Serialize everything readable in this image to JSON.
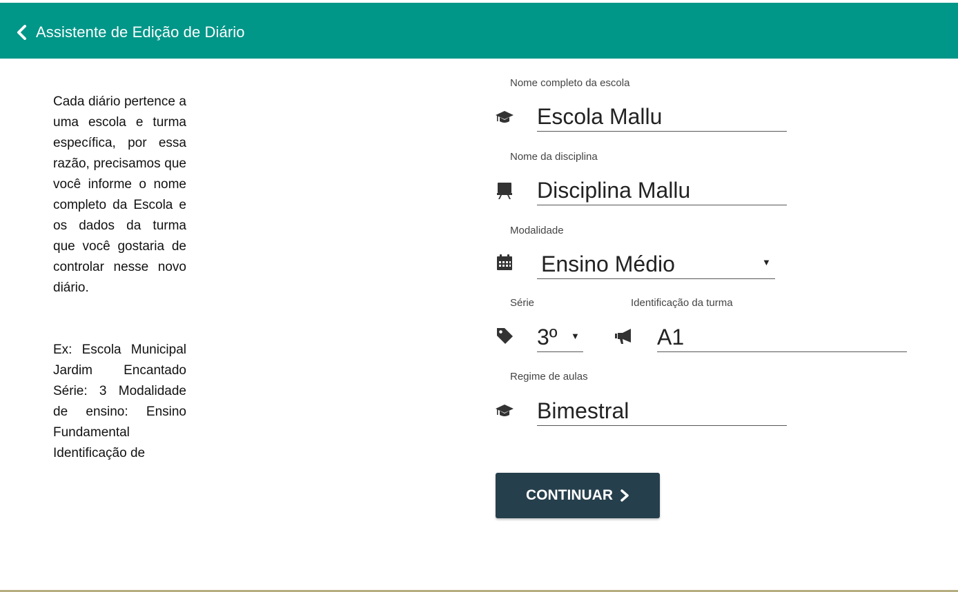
{
  "header": {
    "title": "Assistente de Edição de Diário",
    "back_icon": "chevron-left-icon",
    "background_color": "#009688"
  },
  "intro": {
    "paragraph1": "Cada diário pertence a uma escola e turma específica, por essa razão, precisamos que você informe o nome completo da Escola e os dados da turma que você gostaria de controlar nesse novo diário.",
    "paragraph2": "Ex: Escola Municipal Jardim Encantado Série: 3 Modalidade de ensino: Ensino Fundamental Identificação de"
  },
  "form": {
    "school": {
      "label": "Nome completo da escola",
      "value": "Escola Mallu",
      "icon": "graduation-cap-icon"
    },
    "subject": {
      "label": "Nome da disciplina",
      "value": "Disciplina Mallu",
      "icon": "easel-icon"
    },
    "modality": {
      "label": "Modalidade",
      "value": "Ensino Médio",
      "icon": "calendar-icon"
    },
    "grade": {
      "label": "Série",
      "value": "3º",
      "icon": "tag-icon"
    },
    "class_id": {
      "label": "Identificação da turma",
      "value": "A1",
      "icon": "megaphone-icon"
    },
    "regime": {
      "label": "Regime de aulas",
      "value": "Bimestral",
      "icon": "graduation-cap-icon"
    }
  },
  "actions": {
    "continue_label": "CONTINUAR",
    "continue_icon": "chevron-right-icon",
    "button_color": "#263f4c"
  }
}
